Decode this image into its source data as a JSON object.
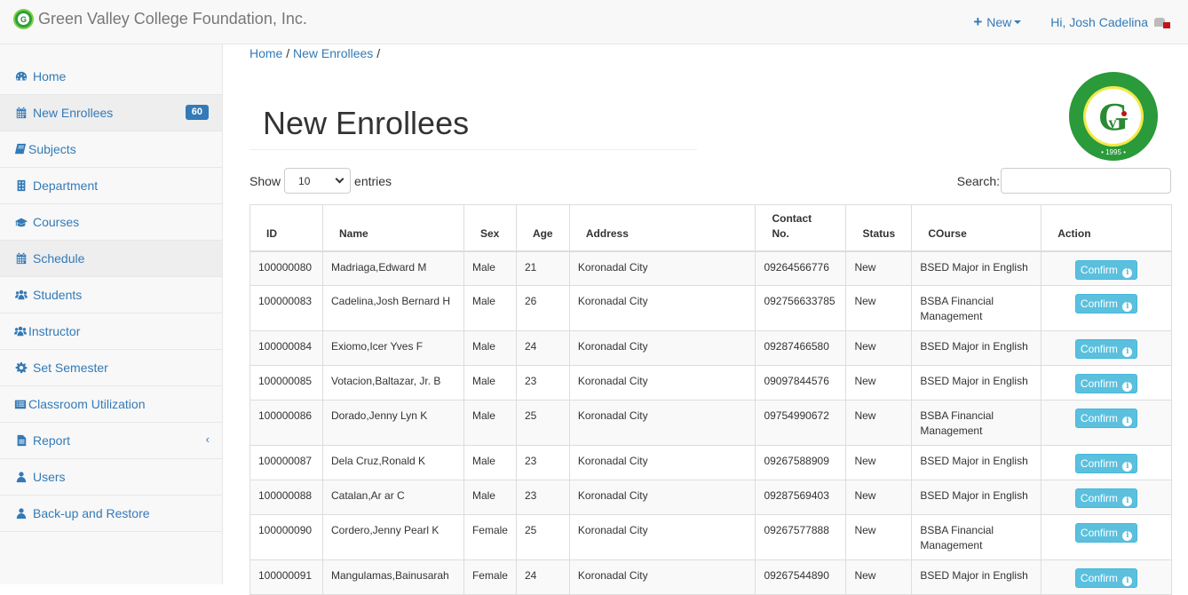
{
  "navbar": {
    "brand": "Green Valley College Foundation, Inc.",
    "new_label": "New",
    "user_greeting": "Hi, Josh Cadelina"
  },
  "sidebar": {
    "items": [
      {
        "label": "Home",
        "icon": "dashboard-icon"
      },
      {
        "label": "New Enrollees",
        "icon": "calendar-icon",
        "badge": "60"
      },
      {
        "label": "Subjects",
        "icon": "book-icon"
      },
      {
        "label": "Department",
        "icon": "building-icon"
      },
      {
        "label": "Courses",
        "icon": "graduation-cap-icon"
      },
      {
        "label": "Schedule",
        "icon": "calendar-icon"
      },
      {
        "label": "Students",
        "icon": "users-icon"
      },
      {
        "label": "Instructor",
        "icon": "users-icon"
      },
      {
        "label": "Set Semester",
        "icon": "gear-icon"
      },
      {
        "label": "Classroom Utilization",
        "icon": "list-icon"
      },
      {
        "label": "Report",
        "icon": "file-icon"
      },
      {
        "label": "Users",
        "icon": "user-icon"
      },
      {
        "label": "Back-up and Restore",
        "icon": "user-icon"
      }
    ]
  },
  "breadcrumb": {
    "home": "Home",
    "current": "New Enrollees",
    "sep": "/"
  },
  "page": {
    "title": "New Enrollees"
  },
  "controls": {
    "show_label": "Show",
    "entries_value": "10",
    "entries_label": "entries",
    "search_label": "Search:",
    "search_value": ""
  },
  "table": {
    "headers": [
      "ID",
      "Name",
      "Sex",
      "Age",
      "Address",
      "Contact No.",
      "Status",
      "COurse",
      "Action"
    ],
    "action_label": "Confirm",
    "rows": [
      {
        "id": "100000080",
        "name": "Madriaga,Edward M",
        "sex": "Male",
        "age": "21",
        "address": "Koronadal City",
        "contact": "09264566776",
        "status": "New",
        "course": "BSED Major in English"
      },
      {
        "id": "100000083",
        "name": "Cadelina,Josh Bernard H",
        "sex": "Male",
        "age": "26",
        "address": "Koronadal City",
        "contact": "092756633785",
        "status": "New",
        "course": "BSBA Financial Management"
      },
      {
        "id": "100000084",
        "name": "Exiomo,Icer Yves F",
        "sex": "Male",
        "age": "24",
        "address": "Koronadal City",
        "contact": "09287466580",
        "status": "New",
        "course": "BSED Major in English"
      },
      {
        "id": "100000085",
        "name": "Votacion,Baltazar, Jr. B",
        "sex": "Male",
        "age": "23",
        "address": "Koronadal City",
        "contact": "09097844576",
        "status": "New",
        "course": "BSED Major in English"
      },
      {
        "id": "100000086",
        "name": "Dorado,Jenny Lyn K",
        "sex": "Male",
        "age": "25",
        "address": "Koronadal City",
        "contact": "09754990672",
        "status": "New",
        "course": "BSBA Financial Management"
      },
      {
        "id": "100000087",
        "name": "Dela Cruz,Ronald K",
        "sex": "Male",
        "age": "23",
        "address": "Koronadal City",
        "contact": "09267588909",
        "status": "New",
        "course": "BSED Major in English"
      },
      {
        "id": "100000088",
        "name": "Catalan,Ar ar C",
        "sex": "Male",
        "age": "23",
        "address": "Koronadal City",
        "contact": "09287569403",
        "status": "New",
        "course": "BSED Major in English"
      },
      {
        "id": "100000090",
        "name": "Cordero,Jenny Pearl K",
        "sex": "Female",
        "age": "25",
        "address": "Koronadal City",
        "contact": "09267577888",
        "status": "New",
        "course": "BSBA Financial Management"
      },
      {
        "id": "100000091",
        "name": "Mangulamas,Bainusarah",
        "sex": "Female",
        "age": "24",
        "address": "Koronadal City",
        "contact": "09267544890",
        "status": "New",
        "course": "BSED Major in English"
      }
    ]
  },
  "colors": {
    "link": "#337ab7",
    "info_button": "#5bc0de",
    "brand_green": "#2f9e3a"
  }
}
